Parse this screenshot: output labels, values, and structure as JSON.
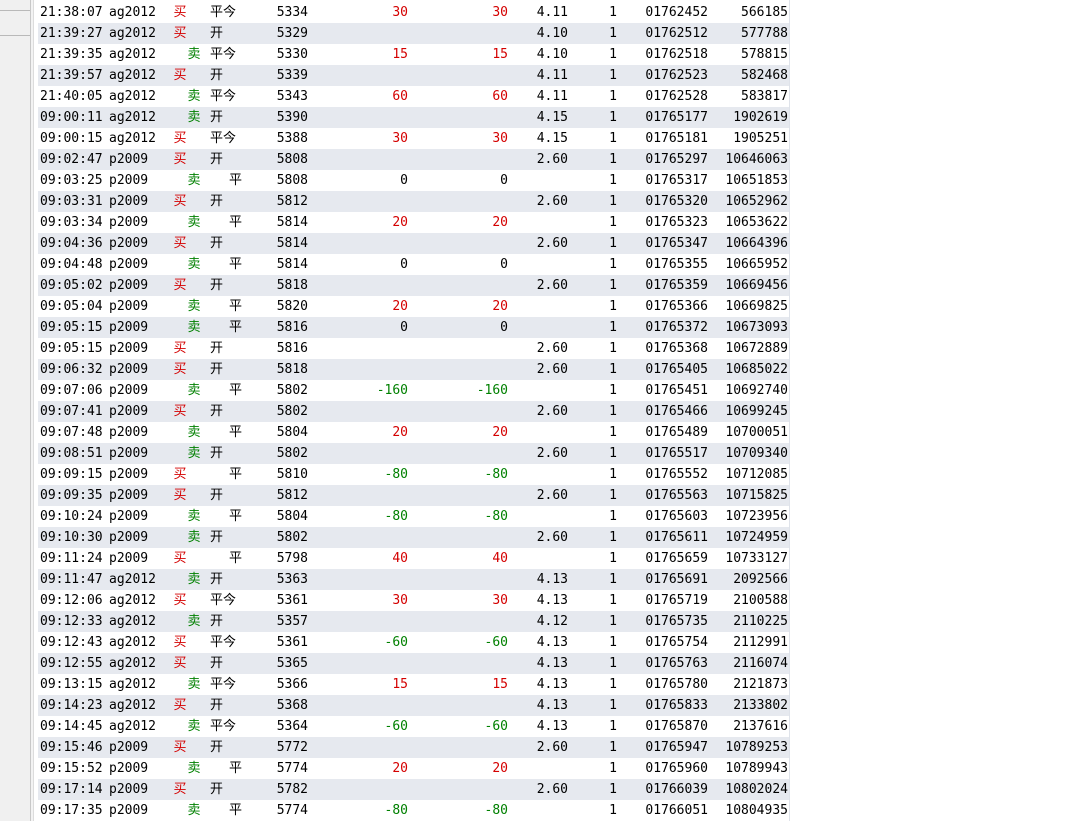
{
  "trade_table": {
    "rows": [
      {
        "time": "21:38:07",
        "instrument": "ag2012",
        "direction": "买",
        "offset": "平今",
        "price": "5334",
        "pnl1": "30",
        "pnl2": "30",
        "fee": "4.11",
        "volume": "1",
        "order_id": "01762452",
        "trade_id": "566185"
      },
      {
        "time": "21:39:27",
        "instrument": "ag2012",
        "direction": "买",
        "offset": "开",
        "price": "5329",
        "pnl1": "",
        "pnl2": "",
        "fee": "4.10",
        "volume": "1",
        "order_id": "01762512",
        "trade_id": "577788"
      },
      {
        "time": "21:39:35",
        "instrument": "ag2012",
        "direction": "卖",
        "offset": "平今",
        "price": "5330",
        "pnl1": "15",
        "pnl2": "15",
        "fee": "4.10",
        "volume": "1",
        "order_id": "01762518",
        "trade_id": "578815"
      },
      {
        "time": "21:39:57",
        "instrument": "ag2012",
        "direction": "买",
        "offset": "开",
        "price": "5339",
        "pnl1": "",
        "pnl2": "",
        "fee": "4.11",
        "volume": "1",
        "order_id": "01762523",
        "trade_id": "582468"
      },
      {
        "time": "21:40:05",
        "instrument": "ag2012",
        "direction": "卖",
        "offset": "平今",
        "price": "5343",
        "pnl1": "60",
        "pnl2": "60",
        "fee": "4.11",
        "volume": "1",
        "order_id": "01762528",
        "trade_id": "583817"
      },
      {
        "time": "09:00:11",
        "instrument": "ag2012",
        "direction": "卖",
        "offset": "开",
        "price": "5390",
        "pnl1": "",
        "pnl2": "",
        "fee": "4.15",
        "volume": "1",
        "order_id": "01765177",
        "trade_id": "1902619"
      },
      {
        "time": "09:00:15",
        "instrument": "ag2012",
        "direction": "买",
        "offset": "平今",
        "price": "5388",
        "pnl1": "30",
        "pnl2": "30",
        "fee": "4.15",
        "volume": "1",
        "order_id": "01765181",
        "trade_id": "1905251"
      },
      {
        "time": "09:02:47",
        "instrument": "p2009",
        "direction": "买",
        "offset": "开",
        "price": "5808",
        "pnl1": "",
        "pnl2": "",
        "fee": "2.60",
        "volume": "1",
        "order_id": "01765297",
        "trade_id": "10646063"
      },
      {
        "time": "09:03:25",
        "instrument": "p2009",
        "direction": "卖",
        "offset": "平",
        "price": "5808",
        "pnl1": "0",
        "pnl2": "0",
        "fee": "",
        "volume": "1",
        "order_id": "01765317",
        "trade_id": "10651853"
      },
      {
        "time": "09:03:31",
        "instrument": "p2009",
        "direction": "买",
        "offset": "开",
        "price": "5812",
        "pnl1": "",
        "pnl2": "",
        "fee": "2.60",
        "volume": "1",
        "order_id": "01765320",
        "trade_id": "10652962"
      },
      {
        "time": "09:03:34",
        "instrument": "p2009",
        "direction": "卖",
        "offset": "平",
        "price": "5814",
        "pnl1": "20",
        "pnl2": "20",
        "fee": "",
        "volume": "1",
        "order_id": "01765323",
        "trade_id": "10653622"
      },
      {
        "time": "09:04:36",
        "instrument": "p2009",
        "direction": "买",
        "offset": "开",
        "price": "5814",
        "pnl1": "",
        "pnl2": "",
        "fee": "2.60",
        "volume": "1",
        "order_id": "01765347",
        "trade_id": "10664396"
      },
      {
        "time": "09:04:48",
        "instrument": "p2009",
        "direction": "卖",
        "offset": "平",
        "price": "5814",
        "pnl1": "0",
        "pnl2": "0",
        "fee": "",
        "volume": "1",
        "order_id": "01765355",
        "trade_id": "10665952"
      },
      {
        "time": "09:05:02",
        "instrument": "p2009",
        "direction": "买",
        "offset": "开",
        "price": "5818",
        "pnl1": "",
        "pnl2": "",
        "fee": "2.60",
        "volume": "1",
        "order_id": "01765359",
        "trade_id": "10669456"
      },
      {
        "time": "09:05:04",
        "instrument": "p2009",
        "direction": "卖",
        "offset": "平",
        "price": "5820",
        "pnl1": "20",
        "pnl2": "20",
        "fee": "",
        "volume": "1",
        "order_id": "01765366",
        "trade_id": "10669825"
      },
      {
        "time": "09:05:15",
        "instrument": "p2009",
        "direction": "卖",
        "offset": "平",
        "price": "5816",
        "pnl1": "0",
        "pnl2": "0",
        "fee": "",
        "volume": "1",
        "order_id": "01765372",
        "trade_id": "10673093"
      },
      {
        "time": "09:05:15",
        "instrument": "p2009",
        "direction": "买",
        "offset": "开",
        "price": "5816",
        "pnl1": "",
        "pnl2": "",
        "fee": "2.60",
        "volume": "1",
        "order_id": "01765368",
        "trade_id": "10672889"
      },
      {
        "time": "09:06:32",
        "instrument": "p2009",
        "direction": "买",
        "offset": "开",
        "price": "5818",
        "pnl1": "",
        "pnl2": "",
        "fee": "2.60",
        "volume": "1",
        "order_id": "01765405",
        "trade_id": "10685022"
      },
      {
        "time": "09:07:06",
        "instrument": "p2009",
        "direction": "卖",
        "offset": "平",
        "price": "5802",
        "pnl1": "-160",
        "pnl2": "-160",
        "fee": "",
        "volume": "1",
        "order_id": "01765451",
        "trade_id": "10692740"
      },
      {
        "time": "09:07:41",
        "instrument": "p2009",
        "direction": "买",
        "offset": "开",
        "price": "5802",
        "pnl1": "",
        "pnl2": "",
        "fee": "2.60",
        "volume": "1",
        "order_id": "01765466",
        "trade_id": "10699245"
      },
      {
        "time": "09:07:48",
        "instrument": "p2009",
        "direction": "卖",
        "offset": "平",
        "price": "5804",
        "pnl1": "20",
        "pnl2": "20",
        "fee": "",
        "volume": "1",
        "order_id": "01765489",
        "trade_id": "10700051"
      },
      {
        "time": "09:08:51",
        "instrument": "p2009",
        "direction": "卖",
        "offset": "开",
        "price": "5802",
        "pnl1": "",
        "pnl2": "",
        "fee": "2.60",
        "volume": "1",
        "order_id": "01765517",
        "trade_id": "10709340"
      },
      {
        "time": "09:09:15",
        "instrument": "p2009",
        "direction": "买",
        "offset": "平",
        "price": "5810",
        "pnl1": "-80",
        "pnl2": "-80",
        "fee": "",
        "volume": "1",
        "order_id": "01765552",
        "trade_id": "10712085"
      },
      {
        "time": "09:09:35",
        "instrument": "p2009",
        "direction": "买",
        "offset": "开",
        "price": "5812",
        "pnl1": "",
        "pnl2": "",
        "fee": "2.60",
        "volume": "1",
        "order_id": "01765563",
        "trade_id": "10715825"
      },
      {
        "time": "09:10:24",
        "instrument": "p2009",
        "direction": "卖",
        "offset": "平",
        "price": "5804",
        "pnl1": "-80",
        "pnl2": "-80",
        "fee": "",
        "volume": "1",
        "order_id": "01765603",
        "trade_id": "10723956"
      },
      {
        "time": "09:10:30",
        "instrument": "p2009",
        "direction": "卖",
        "offset": "开",
        "price": "5802",
        "pnl1": "",
        "pnl2": "",
        "fee": "2.60",
        "volume": "1",
        "order_id": "01765611",
        "trade_id": "10724959"
      },
      {
        "time": "09:11:24",
        "instrument": "p2009",
        "direction": "买",
        "offset": "平",
        "price": "5798",
        "pnl1": "40",
        "pnl2": "40",
        "fee": "",
        "volume": "1",
        "order_id": "01765659",
        "trade_id": "10733127"
      },
      {
        "time": "09:11:47",
        "instrument": "ag2012",
        "direction": "卖",
        "offset": "开",
        "price": "5363",
        "pnl1": "",
        "pnl2": "",
        "fee": "4.13",
        "volume": "1",
        "order_id": "01765691",
        "trade_id": "2092566"
      },
      {
        "time": "09:12:06",
        "instrument": "ag2012",
        "direction": "买",
        "offset": "平今",
        "price": "5361",
        "pnl1": "30",
        "pnl2": "30",
        "fee": "4.13",
        "volume": "1",
        "order_id": "01765719",
        "trade_id": "2100588"
      },
      {
        "time": "09:12:33",
        "instrument": "ag2012",
        "direction": "卖",
        "offset": "开",
        "price": "5357",
        "pnl1": "",
        "pnl2": "",
        "fee": "4.12",
        "volume": "1",
        "order_id": "01765735",
        "trade_id": "2110225"
      },
      {
        "time": "09:12:43",
        "instrument": "ag2012",
        "direction": "买",
        "offset": "平今",
        "price": "5361",
        "pnl1": "-60",
        "pnl2": "-60",
        "fee": "4.13",
        "volume": "1",
        "order_id": "01765754",
        "trade_id": "2112991"
      },
      {
        "time": "09:12:55",
        "instrument": "ag2012",
        "direction": "买",
        "offset": "开",
        "price": "5365",
        "pnl1": "",
        "pnl2": "",
        "fee": "4.13",
        "volume": "1",
        "order_id": "01765763",
        "trade_id": "2116074"
      },
      {
        "time": "09:13:15",
        "instrument": "ag2012",
        "direction": "卖",
        "offset": "平今",
        "price": "5366",
        "pnl1": "15",
        "pnl2": "15",
        "fee": "4.13",
        "volume": "1",
        "order_id": "01765780",
        "trade_id": "2121873"
      },
      {
        "time": "09:14:23",
        "instrument": "ag2012",
        "direction": "买",
        "offset": "开",
        "price": "5368",
        "pnl1": "",
        "pnl2": "",
        "fee": "4.13",
        "volume": "1",
        "order_id": "01765833",
        "trade_id": "2133802"
      },
      {
        "time": "09:14:45",
        "instrument": "ag2012",
        "direction": "卖",
        "offset": "平今",
        "price": "5364",
        "pnl1": "-60",
        "pnl2": "-60",
        "fee": "4.13",
        "volume": "1",
        "order_id": "01765870",
        "trade_id": "2137616"
      },
      {
        "time": "09:15:46",
        "instrument": "p2009",
        "direction": "买",
        "offset": "开",
        "price": "5772",
        "pnl1": "",
        "pnl2": "",
        "fee": "2.60",
        "volume": "1",
        "order_id": "01765947",
        "trade_id": "10789253"
      },
      {
        "time": "09:15:52",
        "instrument": "p2009",
        "direction": "卖",
        "offset": "平",
        "price": "5774",
        "pnl1": "20",
        "pnl2": "20",
        "fee": "",
        "volume": "1",
        "order_id": "01765960",
        "trade_id": "10789943"
      },
      {
        "time": "09:17:14",
        "instrument": "p2009",
        "direction": "买",
        "offset": "开",
        "price": "5782",
        "pnl1": "",
        "pnl2": "",
        "fee": "2.60",
        "volume": "1",
        "order_id": "01766039",
        "trade_id": "10802024"
      },
      {
        "time": "09:17:35",
        "instrument": "p2009",
        "direction": "卖",
        "offset": "平",
        "price": "5774",
        "pnl1": "-80",
        "pnl2": "-80",
        "fee": "",
        "volume": "1",
        "order_id": "01766051",
        "trade_id": "10804935"
      }
    ]
  },
  "colors": {
    "buy": "#d40000",
    "sell": "#008000",
    "row_alt": "#e6e9ef"
  }
}
